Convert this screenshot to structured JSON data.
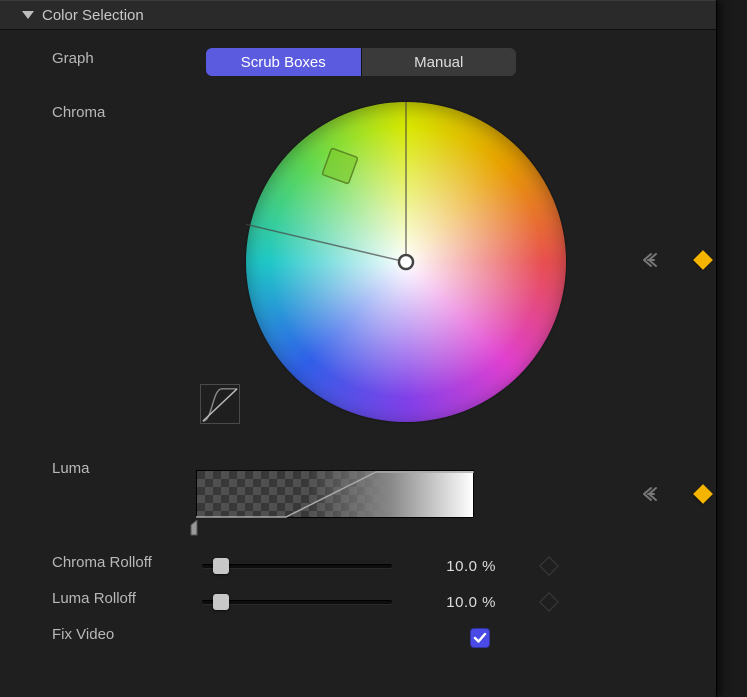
{
  "section": {
    "title": "Color Selection"
  },
  "graph": {
    "label": "Graph",
    "options": [
      "Scrub Boxes",
      "Manual"
    ],
    "selected": "Scrub Boxes"
  },
  "chroma": {
    "label": "Chroma"
  },
  "luma": {
    "label": "Luma"
  },
  "chroma_rolloff": {
    "label": "Chroma Rolloff",
    "value_text": "10.0  %",
    "value": 10.0
  },
  "luma_rolloff": {
    "label": "Luma Rolloff",
    "value_text": "10.0  %",
    "value": 10.0
  },
  "fix_video": {
    "label": "Fix Video",
    "checked": true
  },
  "icons": {
    "reset": "reset-arrow-icon",
    "keyframe": "keyframe-diamond-icon"
  },
  "colors": {
    "accent": "#5b5be0",
    "keyframe_active": "#f5b400",
    "checkbox": "#4a4ae6"
  }
}
